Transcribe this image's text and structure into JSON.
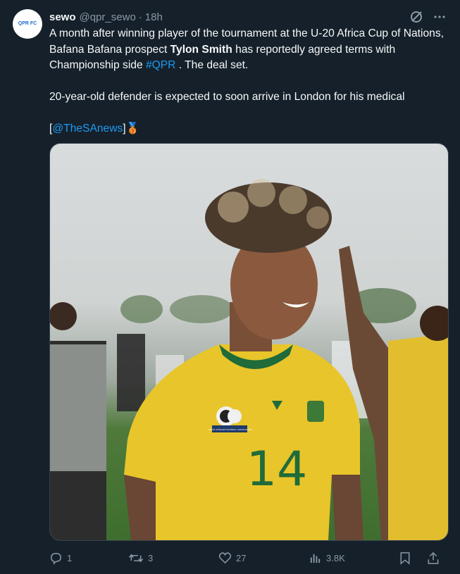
{
  "tweet": {
    "author_name": "sewo",
    "author_handle": "@qpr_sewo",
    "separator": "·",
    "time": "18h",
    "avatar_text": "QPR FC",
    "text_segments": {
      "p1_a": "A month after winning player of the tournament at the U-20 Africa Cup of Nations, Bafana Bafana prospect ",
      "p1_bold": "Tylon Smith",
      "p1_b": " has reportedly agreed terms with Championship side ",
      "p1_hashtag": "#QPR",
      "p1_c": " . The deal set.",
      "p2": "20-year-old defender is expected to soon arrive in London for his medical",
      "p3_open": "[",
      "p3_mention": "@TheSAnews",
      "p3_close": "]",
      "p3_emoji": "🥉"
    },
    "media": {
      "jersey_number": "14",
      "badge_text": "SOUTH AFRICAN FOOTBALL ASSOCIATION"
    },
    "metrics": {
      "replies": "1",
      "reposts": "3",
      "likes": "27",
      "views": "3.8K"
    }
  },
  "colors": {
    "background": "#15202b",
    "text": "#f7f9f9",
    "muted": "#8b98a5",
    "link": "#1d9bf0",
    "jersey_yellow": "#e8c52a",
    "jersey_green": "#1f6b3a"
  }
}
